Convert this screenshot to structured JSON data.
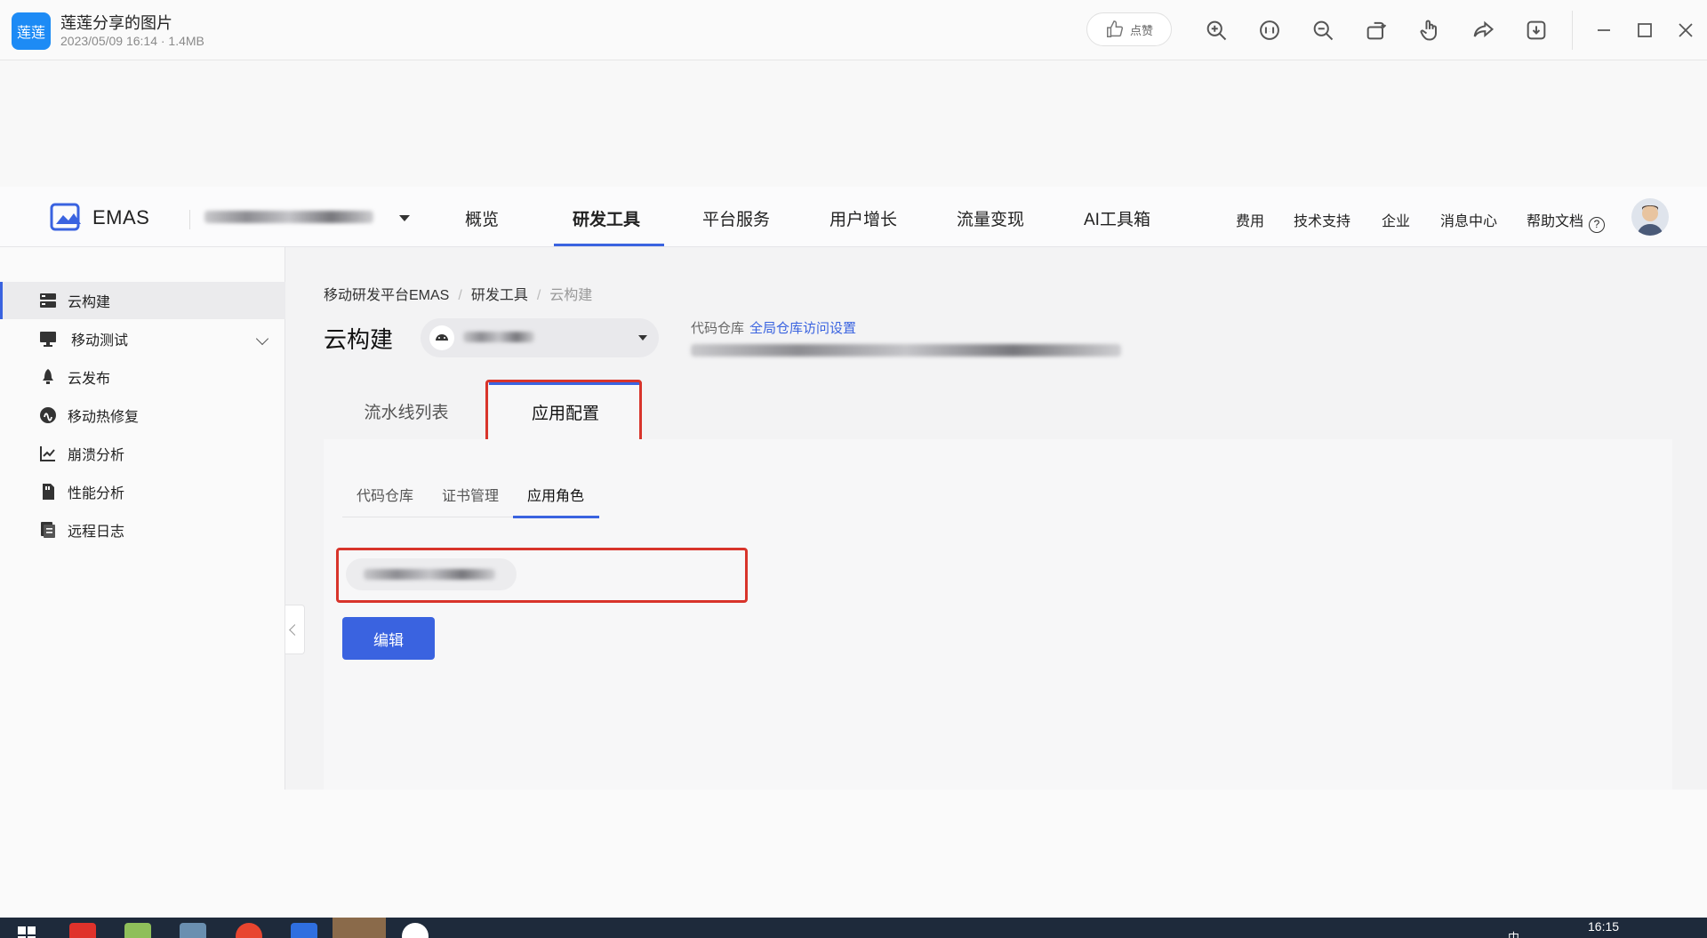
{
  "viewer": {
    "app_logo_text": "莲莲",
    "image_title": "莲莲分享的图片",
    "image_meta": "2023/05/09 16:14 · 1.4MB",
    "like_label": "点赞",
    "tools": [
      "zoom-in-icon",
      "actual-size-icon",
      "zoom-out-icon",
      "rotate-icon",
      "hand-icon",
      "share-icon",
      "download-icon"
    ],
    "window_controls": [
      "minimize-icon",
      "maximize-icon",
      "close-icon"
    ]
  },
  "topnav": {
    "brand": "EMAS",
    "nav_items": [
      "概览",
      "研发工具",
      "平台服务",
      "用户增长",
      "流量变现",
      "AI工具箱"
    ],
    "active_nav": "研发工具",
    "right_links": [
      "费用",
      "技术支持",
      "企业",
      "消息中心",
      "帮助文档"
    ],
    "help_icon_text": "?"
  },
  "sidebar": {
    "items": [
      {
        "label": "云构建",
        "icon": "server-icon",
        "active": true
      },
      {
        "label": "移动测试",
        "icon": "monitor-icon",
        "expandable": true
      },
      {
        "label": "云发布",
        "icon": "rocket-icon"
      },
      {
        "label": "移动热修复",
        "icon": "hotfix-icon"
      },
      {
        "label": "崩溃分析",
        "icon": "crash-chart-icon"
      },
      {
        "label": "性能分析",
        "icon": "performance-icon"
      },
      {
        "label": "远程日志",
        "icon": "log-icon"
      }
    ]
  },
  "main": {
    "breadcrumb": [
      "移动研发平台EMAS",
      "研发工具",
      "云构建"
    ],
    "page_title": "云构建",
    "repo_label": "代码仓库",
    "repo_link": "全局仓库访问设置",
    "tabs": [
      "流水线列表",
      "应用配置"
    ],
    "active_tab": "应用配置",
    "subtabs": [
      "代码仓库",
      "证书管理",
      "应用角色"
    ],
    "active_subtab": "应用角色",
    "edit_button": "编辑"
  },
  "taskbar": {
    "time": "16:15",
    "tray_text": "中"
  },
  "colors": {
    "accent": "#3a63e0",
    "highlight": "#d8342b",
    "viewer_logo": "#1d8bf5"
  }
}
